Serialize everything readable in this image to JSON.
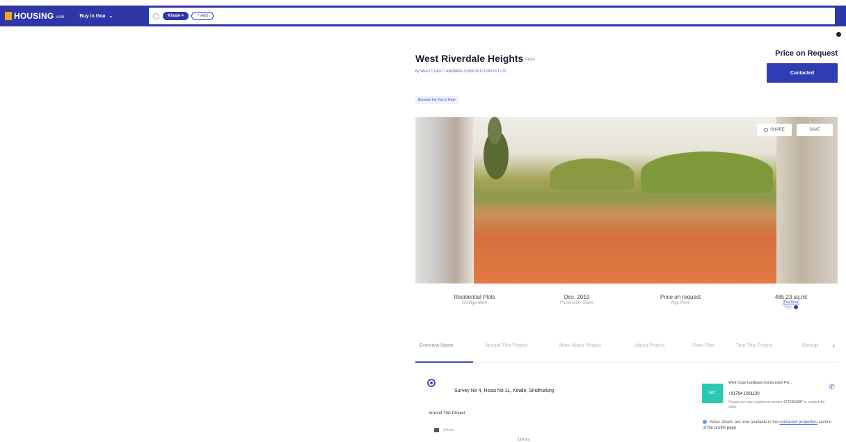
{
  "header": {
    "logo_text": "HOUSING",
    "logo_domain": ".com",
    "buy_dropdown": "Buy in Goa",
    "search_chip": "Kinale",
    "add_chip": "+ Add"
  },
  "project": {
    "title": "West Riverdale Heights",
    "rera_label": "RERA",
    "developer": "By WEST COAST LANDBASE CONSTRUCTION PVT LTD",
    "review_tag": "Become the first to Rate",
    "price_title": "Price on Request",
    "contacted_label": "Contacted"
  },
  "gallery": {
    "share_label": "SHARE",
    "save_label": "SAVE"
  },
  "stats": {
    "config_value": "Residential Plots",
    "config_key": "Configuration",
    "possession_value": "Dec, 2019",
    "possession_key": "Possession Starts",
    "price_value": "Price on request",
    "price_key": "Avg. Price",
    "size_value": "485.23 sq.mt",
    "size_link": "(Plot Area)",
    "size_key": "Size"
  },
  "tabs": [
    "Overview Home",
    "Around This Project",
    "More About Project",
    "About Project",
    "Floor Plan",
    "Tour This Project",
    "Ratings"
  ],
  "location": {
    "address": "Survey No 4, Hissa No 11, Kinale, Sindhudurg",
    "around_title": "Around This Project",
    "school_label": "School",
    "school_distance": "13 Kms"
  },
  "seller": {
    "avatar": "WC",
    "name": "West Coast Landbase Construction Pvt...",
    "phone": "+91794 1061130",
    "note_prefix": "Please use your registered number",
    "note_number": "9775891987",
    "note_suffix": "to contact the seller",
    "notice_prefix": "Seller details are now available in the",
    "notice_link": "contacted properties",
    "notice_suffix": "section of the profile page"
  }
}
